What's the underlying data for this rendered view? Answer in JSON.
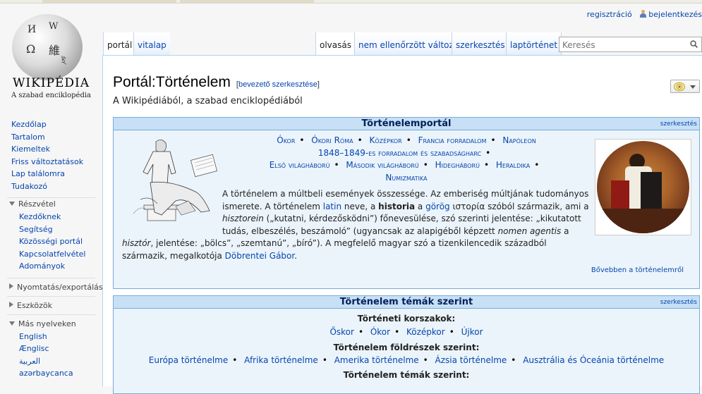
{
  "personal": {
    "register": "regisztráció",
    "login": "bejelentkezés"
  },
  "logo": {
    "wordmark": "WIKIPÉDIA",
    "tagline": "A szabad enciklopédia"
  },
  "sidebar": {
    "nav": [
      "Kezdőlap",
      "Tartalom",
      "Kiemeltek",
      "Friss változtatások",
      "Lap találomra",
      "Tudakozó"
    ],
    "participate": {
      "label": "Részvétel",
      "items": [
        "Kezdőknek",
        "Segítség",
        "Közösségi portál",
        "Kapcsolatfelvétel",
        "Adományok"
      ]
    },
    "print": "Nyomtatás/exportálás",
    "tools": "Eszközök",
    "languages": {
      "label": "Más nyelveken",
      "items": [
        "English",
        "Ænglisc",
        "العربية",
        "azərbaycanca"
      ]
    }
  },
  "tabs": {
    "portal": "portál",
    "talk": "vitalap",
    "read": "olvasás",
    "pending": "nem ellenőrzött változat",
    "edit": "szerkesztés",
    "history": "laptörténet"
  },
  "search": {
    "placeholder": "Keresés"
  },
  "page": {
    "title": "Portál:Történelem",
    "intro_edit": "bevezető szerkesztése",
    "subtitle": "A Wikipédiából, a szabad enciklopédiából"
  },
  "portal_box": {
    "heading": "Történelemportál",
    "edit": "szerkesztés",
    "links": [
      "Ókor",
      "Ókori Róma",
      "Középkor",
      "Francia forradalom",
      "Napóleon",
      "1848–1849-es forradalom és szabadságharc",
      "Első világháború",
      "Második világháború",
      "Hidegháború",
      "Heraldika",
      "Numizmatika"
    ],
    "text": {
      "p1": "A történelem a múltbeli események összessége. Az emberiség múltjának tudományos ismerete. A történelem ",
      "latin": "latin",
      "p2": " neve, a ",
      "historia": "historia",
      "p3": " a ",
      "gorog": "görög",
      "p4": " ιστορία szóból származik, ami a ",
      "histor_in": "hisztorein",
      "p5": " („kutatni, kérdezősködni”) főnevesülése, szó szerinti jelentése: „kikutatott tudás, elbeszélés, beszámoló” (ugyancsak az alapigéből képzett ",
      "nomen": "nomen agentis",
      "p6": " a ",
      "histor": "hisztór",
      "p7": ", jelentése: „bölcs”, „szemtanú”, „bíró”). A megfelelő magyar szó a tizenkilencedik századból származik, megalkotója ",
      "author": "Döbrentei Gábor",
      "p8": "."
    },
    "more": "Bővebben a történelemről"
  },
  "topics_box": {
    "heading": "Történelem témák szerint",
    "edit": "szerkesztés",
    "periods_title": "Történeti korszakok:",
    "periods": [
      "Őskor",
      "Ókor",
      "Középkor",
      "Újkor"
    ],
    "continents_title": "Történelem földrészek szerint:",
    "continents": [
      "Európa történelme",
      "Afrika történelme",
      "Amerika történelme",
      "Ázsia történelme",
      "Ausztrália és Óceánia történelme"
    ],
    "topics_title": "Történelem témák szerint:"
  }
}
